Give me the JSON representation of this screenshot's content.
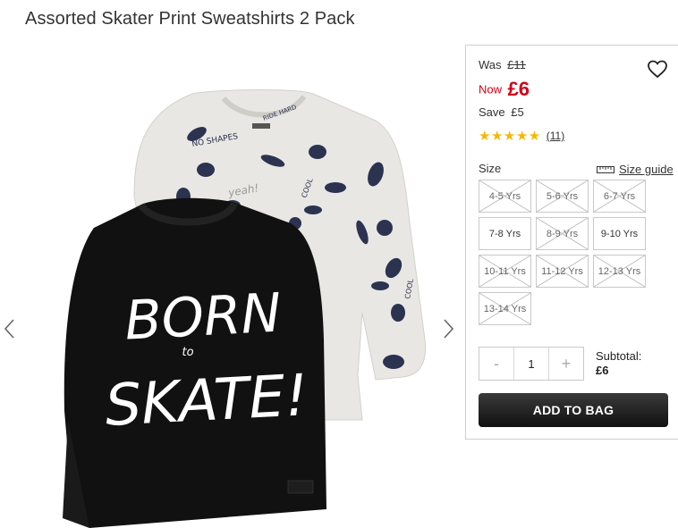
{
  "product": {
    "title": "Assorted Skater Print Sweatshirts 2 Pack"
  },
  "gallery": {
    "front_print_line1": "BORN",
    "front_print_small": "to",
    "front_print_line2": "SKATE!",
    "back_print_words": [
      "NO SHAPES",
      "COOL",
      "yeah!",
      "RIDE HARD",
      "COOL"
    ]
  },
  "pricing": {
    "was_label": "Was",
    "was_amount": "£11",
    "now_label": "Now",
    "now_amount": "£6",
    "save_label": "Save",
    "save_amount": "£5",
    "accent_color": "#d0021b"
  },
  "rating": {
    "stars": 5,
    "count": "(11)"
  },
  "size": {
    "label": "Size",
    "guide_label": "Size guide",
    "options": [
      {
        "label": "4-5 Yrs",
        "available": false
      },
      {
        "label": "5-6 Yrs",
        "available": false
      },
      {
        "label": "6-7 Yrs",
        "available": false
      },
      {
        "label": "7-8 Yrs",
        "available": true
      },
      {
        "label": "8-9 Yrs",
        "available": false
      },
      {
        "label": "9-10 Yrs",
        "available": true
      },
      {
        "label": "10-11 Yrs",
        "available": false
      },
      {
        "label": "11-12 Yrs",
        "available": false
      },
      {
        "label": "12-13 Yrs",
        "available": false
      },
      {
        "label": "13-14 Yrs",
        "available": false
      }
    ]
  },
  "quantity": {
    "minus": "-",
    "value": "1",
    "plus": "+"
  },
  "subtotal": {
    "label": "Subtotal:",
    "amount": "£6"
  },
  "cta": {
    "add_to_bag": "ADD TO BAG"
  }
}
